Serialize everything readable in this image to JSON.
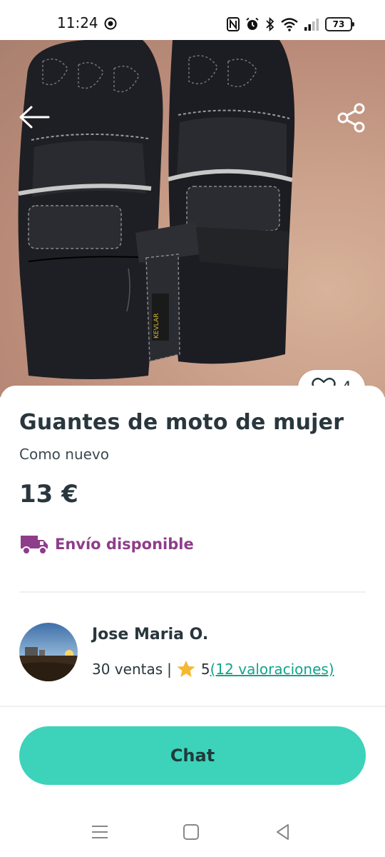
{
  "status_bar": {
    "time": "11:24",
    "battery": "73",
    "icons": [
      "target-icon",
      "nfc-icon",
      "alarm-icon",
      "bluetooth-icon",
      "wifi-icon",
      "signal-icon",
      "battery-icon"
    ]
  },
  "listing": {
    "title": "Guantes de moto de mujer",
    "condition": "Como nuevo",
    "price": "13 €",
    "shipping_label": "Envío disponible",
    "favorites_count": "4"
  },
  "seller": {
    "name": "Jose Maria O.",
    "sales": "30 ventas",
    "separator": "|",
    "rating": "5",
    "reviews": "(12 valoraciones)"
  },
  "actions": {
    "chat_label": "Chat"
  },
  "colors": {
    "accent": "#3dd2ba",
    "shipping": "#8e3d8a",
    "link": "#13a38a",
    "star": "#f5b82e"
  }
}
